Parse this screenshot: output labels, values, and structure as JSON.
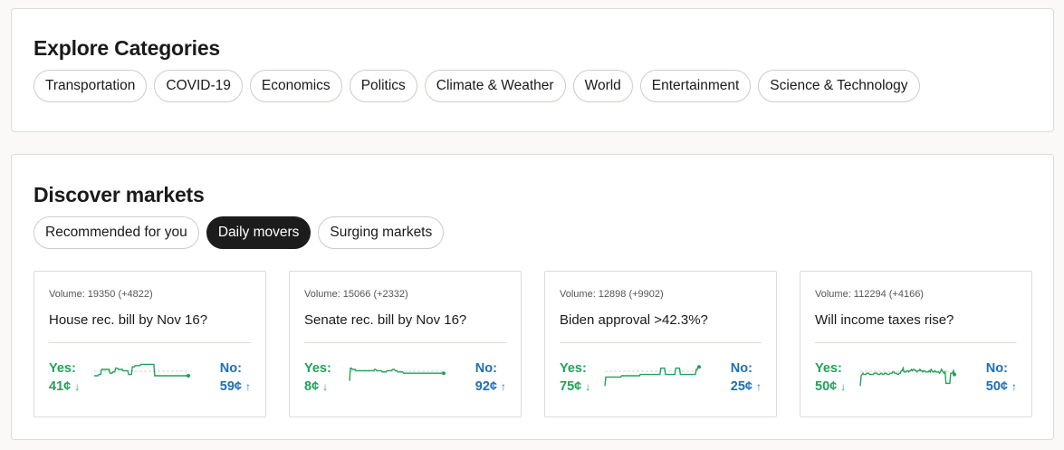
{
  "explore": {
    "title": "Explore Categories",
    "categories": [
      "Transportation",
      "COVID-19",
      "Economics",
      "Politics",
      "Climate & Weather",
      "World",
      "Entertainment",
      "Science & Technology"
    ]
  },
  "discover": {
    "title": "Discover markets",
    "tabs": [
      {
        "label": "Recommended for you",
        "active": false
      },
      {
        "label": "Daily movers",
        "active": true
      },
      {
        "label": "Surging markets",
        "active": false
      }
    ],
    "markets": [
      {
        "volume": "Volume: 19350 (+4822)",
        "title": "House rec. bill by Nov 16?",
        "yes_label": "Yes:",
        "yes_price": "41¢",
        "yes_trend": "down",
        "no_label": "No:",
        "no_price": "59¢",
        "no_trend": "up",
        "sparkline": [
          0.5,
          0.5,
          0.5,
          0.5,
          0.5,
          0.45,
          0.45,
          0.45,
          0.25,
          0.25,
          0.25,
          0.25,
          0.25,
          0.25,
          0.25,
          0.25,
          0.25,
          0.4,
          0.4,
          0.4,
          0.35,
          0.35,
          0.35,
          0.2,
          0.2,
          0.2,
          0.25,
          0.25,
          0.25,
          0.25,
          0.25,
          0.3,
          0.3,
          0.3,
          0.3,
          0.3,
          0.3,
          0.45,
          0.45,
          0.45,
          0.45,
          0.15,
          0.15,
          0.15,
          0.1,
          0.1,
          0.1,
          0.1,
          0.1,
          0.1,
          0.05,
          0.05,
          0.05,
          0.05,
          0.05,
          0.05,
          0.05,
          0.05,
          0.05,
          0.05,
          0.05,
          0.05,
          0.05,
          0.05,
          0.05,
          0.5,
          0.5,
          0.5,
          0.5,
          0.5,
          0.5,
          0.5,
          0.5,
          0.5,
          0.5,
          0.5,
          0.5,
          0.5,
          0.5,
          0.5,
          0.5,
          0.5,
          0.5,
          0.5,
          0.5,
          0.5,
          0.5,
          0.5,
          0.5,
          0.5,
          0.5,
          0.5,
          0.5,
          0.5,
          0.5,
          0.5,
          0.5,
          0.5,
          0.5,
          0.5,
          0.5,
          0.5
        ],
        "sparkline_color": "#23a059"
      },
      {
        "volume": "Volume: 15066 (+2332)",
        "title": "Senate rec. bill by Nov 16?",
        "yes_label": "Yes:",
        "yes_price": "8¢",
        "yes_trend": "down",
        "no_label": "No:",
        "no_price": "92¢",
        "no_trend": "up",
        "sparkline": [
          0.7,
          0.2,
          0.2,
          0.25,
          0.25,
          0.25,
          0.25,
          0.3,
          0.3,
          0.3,
          0.3,
          0.3,
          0.3,
          0.3,
          0.3,
          0.3,
          0.3,
          0.3,
          0.3,
          0.3,
          0.3,
          0.3,
          0.3,
          0.3,
          0.3,
          0.3,
          0.3,
          0.25,
          0.25,
          0.3,
          0.3,
          0.3,
          0.3,
          0.3,
          0.3,
          0.35,
          0.35,
          0.35,
          0.35,
          0.35,
          0.3,
          0.3,
          0.3,
          0.3,
          0.3,
          0.3,
          0.25,
          0.25,
          0.25,
          0.3,
          0.3,
          0.3,
          0.35,
          0.35,
          0.35,
          0.35,
          0.35,
          0.35,
          0.4,
          0.4,
          0.4,
          0.4,
          0.4,
          0.4,
          0.4,
          0.4,
          0.4,
          0.4,
          0.4,
          0.4,
          0.4,
          0.4,
          0.4,
          0.4,
          0.4,
          0.4,
          0.4,
          0.4,
          0.4,
          0.4,
          0.4,
          0.4,
          0.4,
          0.4,
          0.4,
          0.4,
          0.4,
          0.4,
          0.4,
          0.4,
          0.4,
          0.4,
          0.4,
          0.4,
          0.4,
          0.4,
          0.4,
          0.4,
          0.4,
          0.4,
          0.4,
          0.4
        ],
        "sparkline_color": "#23a059"
      },
      {
        "volume": "Volume: 12898 (+9902)",
        "title": "Biden approval >42.3%?",
        "yes_label": "Yes:",
        "yes_price": "75¢",
        "yes_trend": "down",
        "no_label": "No:",
        "no_price": "25¢",
        "no_trend": "up",
        "sparkline": [
          0.9,
          0.55,
          0.55,
          0.55,
          0.55,
          0.55,
          0.55,
          0.55,
          0.55,
          0.55,
          0.55,
          0.55,
          0.55,
          0.55,
          0.55,
          0.55,
          0.55,
          0.55,
          0.5,
          0.5,
          0.5,
          0.5,
          0.5,
          0.5,
          0.5,
          0.5,
          0.5,
          0.5,
          0.5,
          0.5,
          0.5,
          0.5,
          0.5,
          0.5,
          0.5,
          0.5,
          0.5,
          0.5,
          0.45,
          0.45,
          0.45,
          0.45,
          0.45,
          0.45,
          0.45,
          0.45,
          0.45,
          0.45,
          0.45,
          0.45,
          0.45,
          0.45,
          0.45,
          0.45,
          0.45,
          0.45,
          0.45,
          0.45,
          0.45,
          0.45,
          0.2,
          0.2,
          0.2,
          0.2,
          0.2,
          0.45,
          0.45,
          0.45,
          0.45,
          0.45,
          0.45,
          0.45,
          0.45,
          0.45,
          0.45,
          0.45,
          0.2,
          0.2,
          0.2,
          0.2,
          0.2,
          0.45,
          0.45,
          0.45,
          0.45,
          0.45,
          0.45,
          0.45,
          0.45,
          0.45,
          0.45,
          0.45,
          0.45,
          0.45,
          0.45,
          0.45,
          0.45,
          0.45,
          0.25,
          0.25,
          0.15,
          0.15
        ],
        "sparkline_color": "#23a059"
      },
      {
        "volume": "Volume: 112294 (+4166)",
        "title": "Will income taxes rise?",
        "yes_label": "Yes:",
        "yes_price": "50¢",
        "yes_trend": "down",
        "no_label": "No:",
        "no_price": "50¢",
        "no_trend": "up",
        "sparkline": [
          0.9,
          0.5,
          0.45,
          0.4,
          0.45,
          0.45,
          0.45,
          0.4,
          0.4,
          0.4,
          0.45,
          0.45,
          0.45,
          0.45,
          0.45,
          0.4,
          0.4,
          0.4,
          0.4,
          0.45,
          0.45,
          0.45,
          0.4,
          0.4,
          0.45,
          0.45,
          0.4,
          0.4,
          0.4,
          0.45,
          0.45,
          0.45,
          0.4,
          0.4,
          0.4,
          0.35,
          0.35,
          0.4,
          0.4,
          0.4,
          0.45,
          0.45,
          0.4,
          0.4,
          0.3,
          0.3,
          0.2,
          0.35,
          0.35,
          0.35,
          0.3,
          0.3,
          0.35,
          0.3,
          0.3,
          0.25,
          0.3,
          0.25,
          0.25,
          0.3,
          0.3,
          0.35,
          0.3,
          0.3,
          0.25,
          0.3,
          0.3,
          0.35,
          0.3,
          0.3,
          0.35,
          0.35,
          0.35,
          0.35,
          0.3,
          0.35,
          0.25,
          0.3,
          0.35,
          0.35,
          0.3,
          0.35,
          0.35,
          0.35,
          0.35,
          0.4,
          0.35,
          0.25,
          0.3,
          0.35,
          0.4,
          0.35,
          0.8,
          0.8,
          0.8,
          0.8,
          0.8,
          0.4,
          0.4,
          0.4,
          0.3,
          0.45
        ],
        "sparkline_color": "#23a059"
      }
    ]
  },
  "colors": {
    "yes": "#23a059",
    "no": "#1f6fb2",
    "active_tab_bg": "#1c1c1c",
    "border": "#dedbd6"
  },
  "icons": {
    "yes_trend": "arrow-down-icon",
    "no_trend": "arrow-up-icon"
  }
}
